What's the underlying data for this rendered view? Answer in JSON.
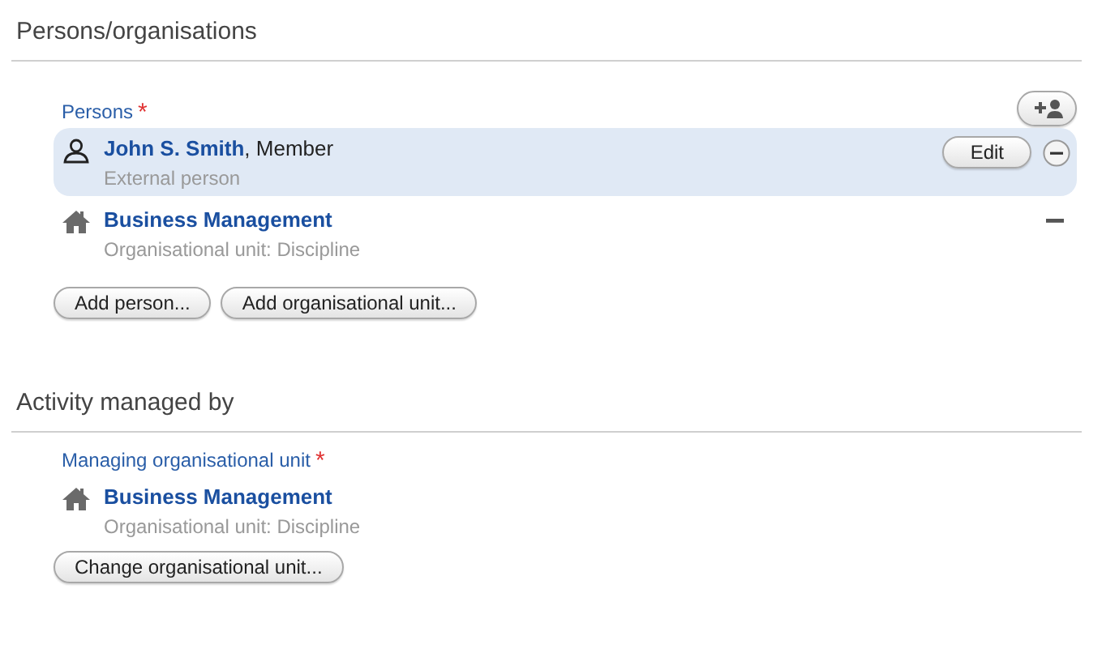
{
  "sections": [
    {
      "title": "Persons/organisations",
      "field": {
        "label": "Persons",
        "required_mark": "*",
        "add_icon_button": true,
        "rows": [
          {
            "kind": "person",
            "name": "John S. Smith",
            "role": ", Member",
            "subtitle": "External person",
            "selected": true,
            "removable": true,
            "edit_label": "Edit"
          },
          {
            "kind": "unit",
            "name": "Business Management",
            "subtitle": "Organisational unit: Discipline",
            "selected": false,
            "removable": true
          }
        ],
        "buttons": [
          "Add person...",
          "Add organisational unit..."
        ]
      }
    },
    {
      "title": "Activity managed by",
      "field": {
        "label": "Managing organisational unit",
        "required_mark": "*",
        "rows": [
          {
            "kind": "unit",
            "name": "Business Management",
            "subtitle": "Organisational unit: Discipline",
            "selected": false,
            "removable": false
          }
        ],
        "buttons": [
          "Change organisational unit..."
        ]
      }
    }
  ]
}
